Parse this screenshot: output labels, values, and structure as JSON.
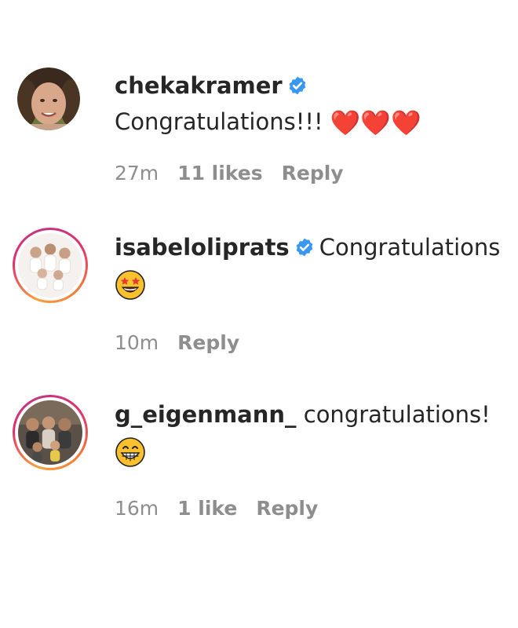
{
  "comments": [
    {
      "username": "chekakramer",
      "verified": true,
      "text": "Congratulations!!!",
      "emoji": "❤️❤️❤️",
      "emoji_name": "red-heart",
      "time": "27m",
      "likes": "11 likes",
      "reply_label": "Reply",
      "avatar_ring": false
    },
    {
      "username": "isabeloliprats",
      "verified": true,
      "text": "Congratulations",
      "emoji": "🤩",
      "emoji_name": "star-struck-emoji",
      "time": "10m",
      "likes": "",
      "reply_label": "Reply",
      "avatar_ring": true
    },
    {
      "username": "g_eigenmann_",
      "verified": false,
      "text": "congratulations!",
      "emoji": "😁",
      "emoji_name": "grinning-emoji",
      "time": "16m",
      "likes": "1 like",
      "reply_label": "Reply",
      "avatar_ring": true
    }
  ],
  "colors": {
    "verified_badge": "#3897f0",
    "heart": "#e0162b",
    "muted_text": "#8e8e8e",
    "primary_text": "#262626",
    "story_ring_start": "#f9a13a",
    "story_ring_end": "#c13584"
  }
}
